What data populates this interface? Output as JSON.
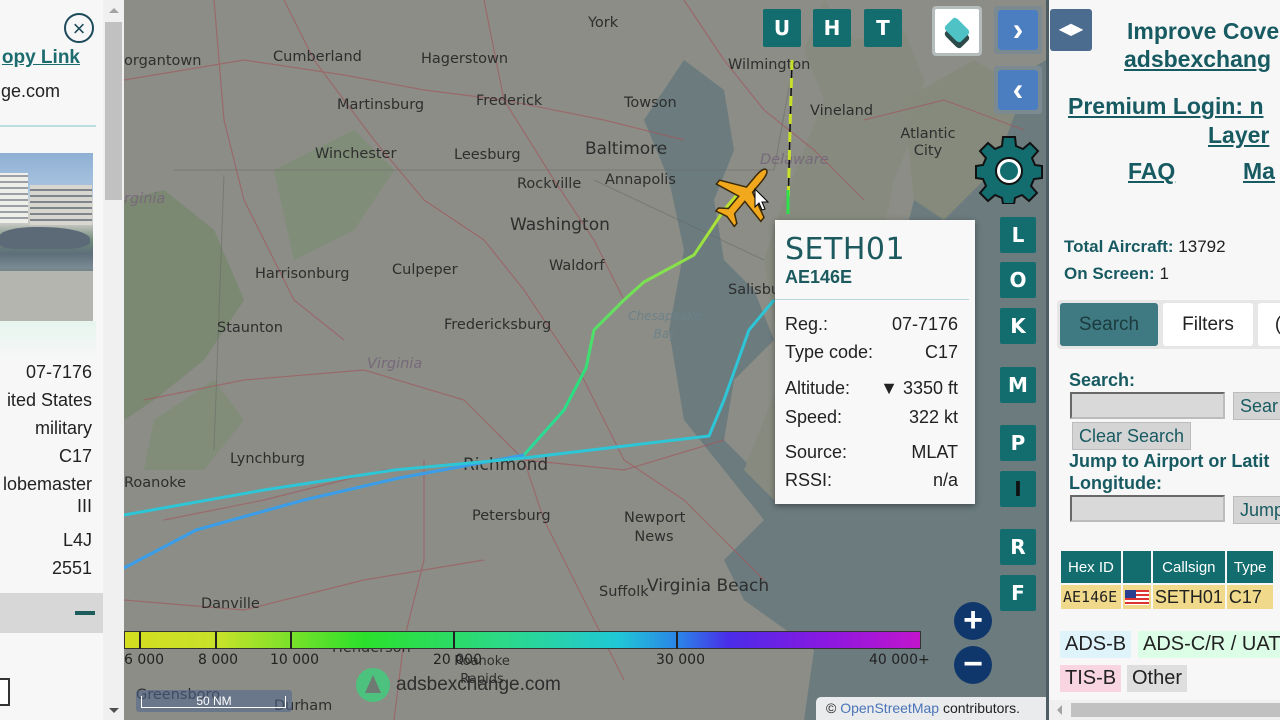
{
  "left_panel": {
    "copy_link_label": "opy Link",
    "domain_text": "ge.com",
    "details": [
      {
        "key": "registration",
        "value": "07-7176"
      },
      {
        "key": "country",
        "value": "ited States"
      },
      {
        "key": "category",
        "value": "military"
      },
      {
        "key": "type",
        "value": "C17"
      },
      {
        "key": "type_full_line1",
        "value": "lobemaster"
      },
      {
        "key": "type_full_line2",
        "value": "III"
      },
      {
        "key": "wtc",
        "value": "L4J"
      },
      {
        "key": "squawk",
        "value": "2551"
      }
    ],
    "close_icon": "×"
  },
  "map": {
    "top_buttons": [
      "U",
      "H",
      "T"
    ],
    "layers_icon": "layers-icon",
    "nav_next": "›",
    "nav_prev": "‹",
    "side_buttons": [
      "L",
      "O",
      "K",
      "M",
      "P",
      "I",
      "R",
      "F"
    ],
    "zoom_in": "+",
    "zoom_out": "−",
    "cities": [
      {
        "name": "York"
      },
      {
        "name": "organtown"
      },
      {
        "name": "Cumberland"
      },
      {
        "name": "Hagerstown"
      },
      {
        "name": "Wilmington"
      },
      {
        "name": "Martinsburg"
      },
      {
        "name": "Frederick"
      },
      {
        "name": "Towson"
      },
      {
        "name": "Vineland"
      },
      {
        "name": "Atlantic City"
      },
      {
        "name": "Winchester"
      },
      {
        "name": "Leesburg"
      },
      {
        "name": "Baltimore"
      },
      {
        "name": "Delaware"
      },
      {
        "name": "Rockville"
      },
      {
        "name": "Annapolis"
      },
      {
        "name": "rginia"
      },
      {
        "name": "Washington"
      },
      {
        "name": "Harrisonburg"
      },
      {
        "name": "Culpeper"
      },
      {
        "name": "Waldorf"
      },
      {
        "name": "Salisbury"
      },
      {
        "name": "Staunton"
      },
      {
        "name": "Fredericksburg"
      },
      {
        "name": "Chesapeake Bay"
      },
      {
        "name": "Virginia"
      },
      {
        "name": "Lynchburg"
      },
      {
        "name": "Richmond"
      },
      {
        "name": "Roanoke"
      },
      {
        "name": "Petersburg"
      },
      {
        "name": "Newport News"
      },
      {
        "name": "Virginia Beach"
      },
      {
        "name": "Suffolk"
      },
      {
        "name": "Danville"
      },
      {
        "name": "Henderson"
      },
      {
        "name": "Roanoke Rapids"
      },
      {
        "name": "Greensboro"
      },
      {
        "name": "Durham"
      }
    ],
    "scale_label": "50 NM",
    "watermark": "adsbexchange.com",
    "attribution_prefix": "©",
    "attribution_link": "OpenStreetMap",
    "attribution_suffix": "contributors.",
    "altitude_legend": {
      "labels": [
        "6 000",
        "8 000",
        "10 000",
        "20 000",
        "30 000",
        "40 000+"
      ]
    }
  },
  "popup": {
    "callsign": "SETH01",
    "hex": "AE146E",
    "rows": [
      {
        "label": "Reg.:",
        "value": "07-7176"
      },
      {
        "label": "Type code:",
        "value": "C17"
      },
      {
        "label": "Altitude:",
        "value": "▼ 3350 ft"
      },
      {
        "label": "Speed:",
        "value": "322 kt"
      },
      {
        "label": "Source:",
        "value": "MLAT"
      },
      {
        "label": "RSSI:",
        "value": "n/a"
      }
    ]
  },
  "right_panel": {
    "toggle_icon": "◀▶",
    "improve_coverage": "Improve Cove",
    "adsbexchange_link": "adsbexchang",
    "premium_login_line1": "Premium Login: n",
    "premium_login_line2": "Layer",
    "faq_link": "FAQ",
    "map_link": "Ma",
    "total_aircraft_label": "Total Aircraft:",
    "total_aircraft_value": "13792",
    "on_screen_label": "On Screen:",
    "on_screen_value": "1",
    "tabs": [
      "Search",
      "Filters",
      "("
    ],
    "active_tab": "Search",
    "search_label": "Search:",
    "search_value": "",
    "search_button": "Sear",
    "clear_search_button": "Clear Search",
    "jump_label_line1": "Jump to Airport or Latit",
    "jump_label_line2": "Longitude:",
    "jump_value": "",
    "jump_button": "Jump",
    "table": {
      "headers": [
        "Hex ID",
        "",
        "Callsign",
        "Type"
      ],
      "rows": [
        {
          "hex": "AE146E",
          "flag": "us-flag",
          "callsign": "SETH01",
          "type": "C17"
        }
      ]
    },
    "source_legend": [
      {
        "label": "ADS-B",
        "color": "#dff3fb"
      },
      {
        "label": "ADS-C/R / UAT",
        "color": "#dcfde6"
      },
      {
        "label": "TIS-B",
        "color": "#f8d5e1"
      },
      {
        "label": "Other",
        "color": "#dedede"
      }
    ]
  },
  "colors": {
    "accent_teal": "#136d6f",
    "aircraft_marker": "#f2a81d",
    "link_teal": "#175a61"
  }
}
